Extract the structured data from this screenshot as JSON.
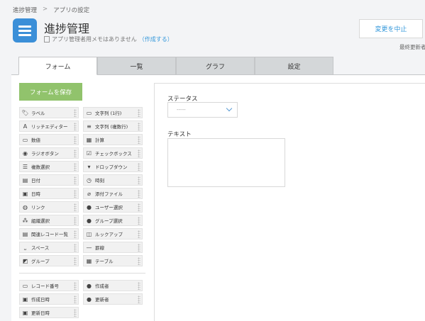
{
  "breadcrumb": {
    "items": [
      "進捗管理",
      "アプリの設定"
    ],
    "separator": ">"
  },
  "app": {
    "title": "進捗管理",
    "memo_text": "アプリ管理者用メモはありません",
    "memo_link": "（作成する）"
  },
  "header": {
    "cancel_label": "変更を中止",
    "last_updated": "最終更新者"
  },
  "tabs": [
    "フォーム",
    "一覧",
    "グラフ",
    "設定"
  ],
  "toolbar": {
    "save_label": "フォームを保存"
  },
  "palette": {
    "fields": [
      {
        "label": "ラベル",
        "icon": "label-icon"
      },
      {
        "label": "文字列 (1行)",
        "icon": "text-single-icon"
      },
      {
        "label": "リッチエディター",
        "icon": "rich-editor-icon"
      },
      {
        "label": "文字列 (複数行)",
        "icon": "text-multi-icon"
      },
      {
        "label": "数値",
        "icon": "number-icon"
      },
      {
        "label": "計算",
        "icon": "calculator-icon"
      },
      {
        "label": "ラジオボタン",
        "icon": "radio-icon"
      },
      {
        "label": "チェックボックス",
        "icon": "checkbox-icon"
      },
      {
        "label": "複数選択",
        "icon": "multi-select-icon"
      },
      {
        "label": "ドロップダウン",
        "icon": "dropdown-icon"
      },
      {
        "label": "日付",
        "icon": "date-icon"
      },
      {
        "label": "時刻",
        "icon": "clock-icon"
      },
      {
        "label": "日時",
        "icon": "datetime-icon"
      },
      {
        "label": "添付ファイル",
        "icon": "paperclip-icon"
      },
      {
        "label": "リンク",
        "icon": "globe-icon"
      },
      {
        "label": "ユーザー選択",
        "icon": "user-icon"
      },
      {
        "label": "組織選択",
        "icon": "org-icon"
      },
      {
        "label": "グループ選択",
        "icon": "group-icon"
      },
      {
        "label": "関連レコード一覧",
        "icon": "related-records-icon"
      },
      {
        "label": "ルックアップ",
        "icon": "lookup-icon"
      },
      {
        "label": "スペース",
        "icon": "space-icon"
      },
      {
        "label": "罫線",
        "icon": "line-icon"
      },
      {
        "label": "グループ",
        "icon": "field-group-icon"
      },
      {
        "label": "テーブル",
        "icon": "table-icon"
      }
    ],
    "system_fields": [
      {
        "label": "レコード番号",
        "icon": "record-number-icon"
      },
      {
        "label": "作成者",
        "icon": "user-icon"
      },
      {
        "label": "作成日時",
        "icon": "datetime-icon"
      },
      {
        "label": "更新者",
        "icon": "user-icon"
      },
      {
        "label": "更新日時",
        "icon": "datetime-icon"
      }
    ]
  },
  "form": {
    "status_label": "ステータス",
    "status_value": "-----",
    "text_label": "テキスト"
  },
  "colors": {
    "accent": "#3498db",
    "save": "#91c36c",
    "app_icon": "#3b8fd8"
  }
}
